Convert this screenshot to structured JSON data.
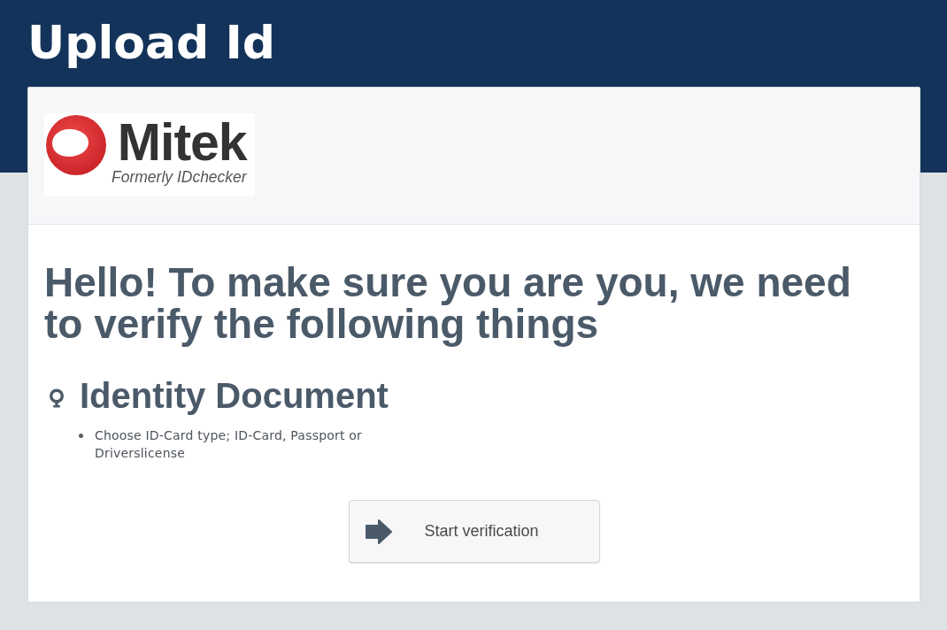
{
  "header": {
    "title": "Upload Id"
  },
  "logo": {
    "name": "Mitek",
    "tagline": "Formerly IDchecker"
  },
  "intro": {
    "heading": "Hello! To make sure you are you, we need to verify the following things"
  },
  "requirements": [
    {
      "title": "Identity Document",
      "items": [
        "Choose ID-Card type; ID-Card, Passport or Driverslicense"
      ]
    }
  ],
  "button": {
    "label": "Start verification"
  }
}
